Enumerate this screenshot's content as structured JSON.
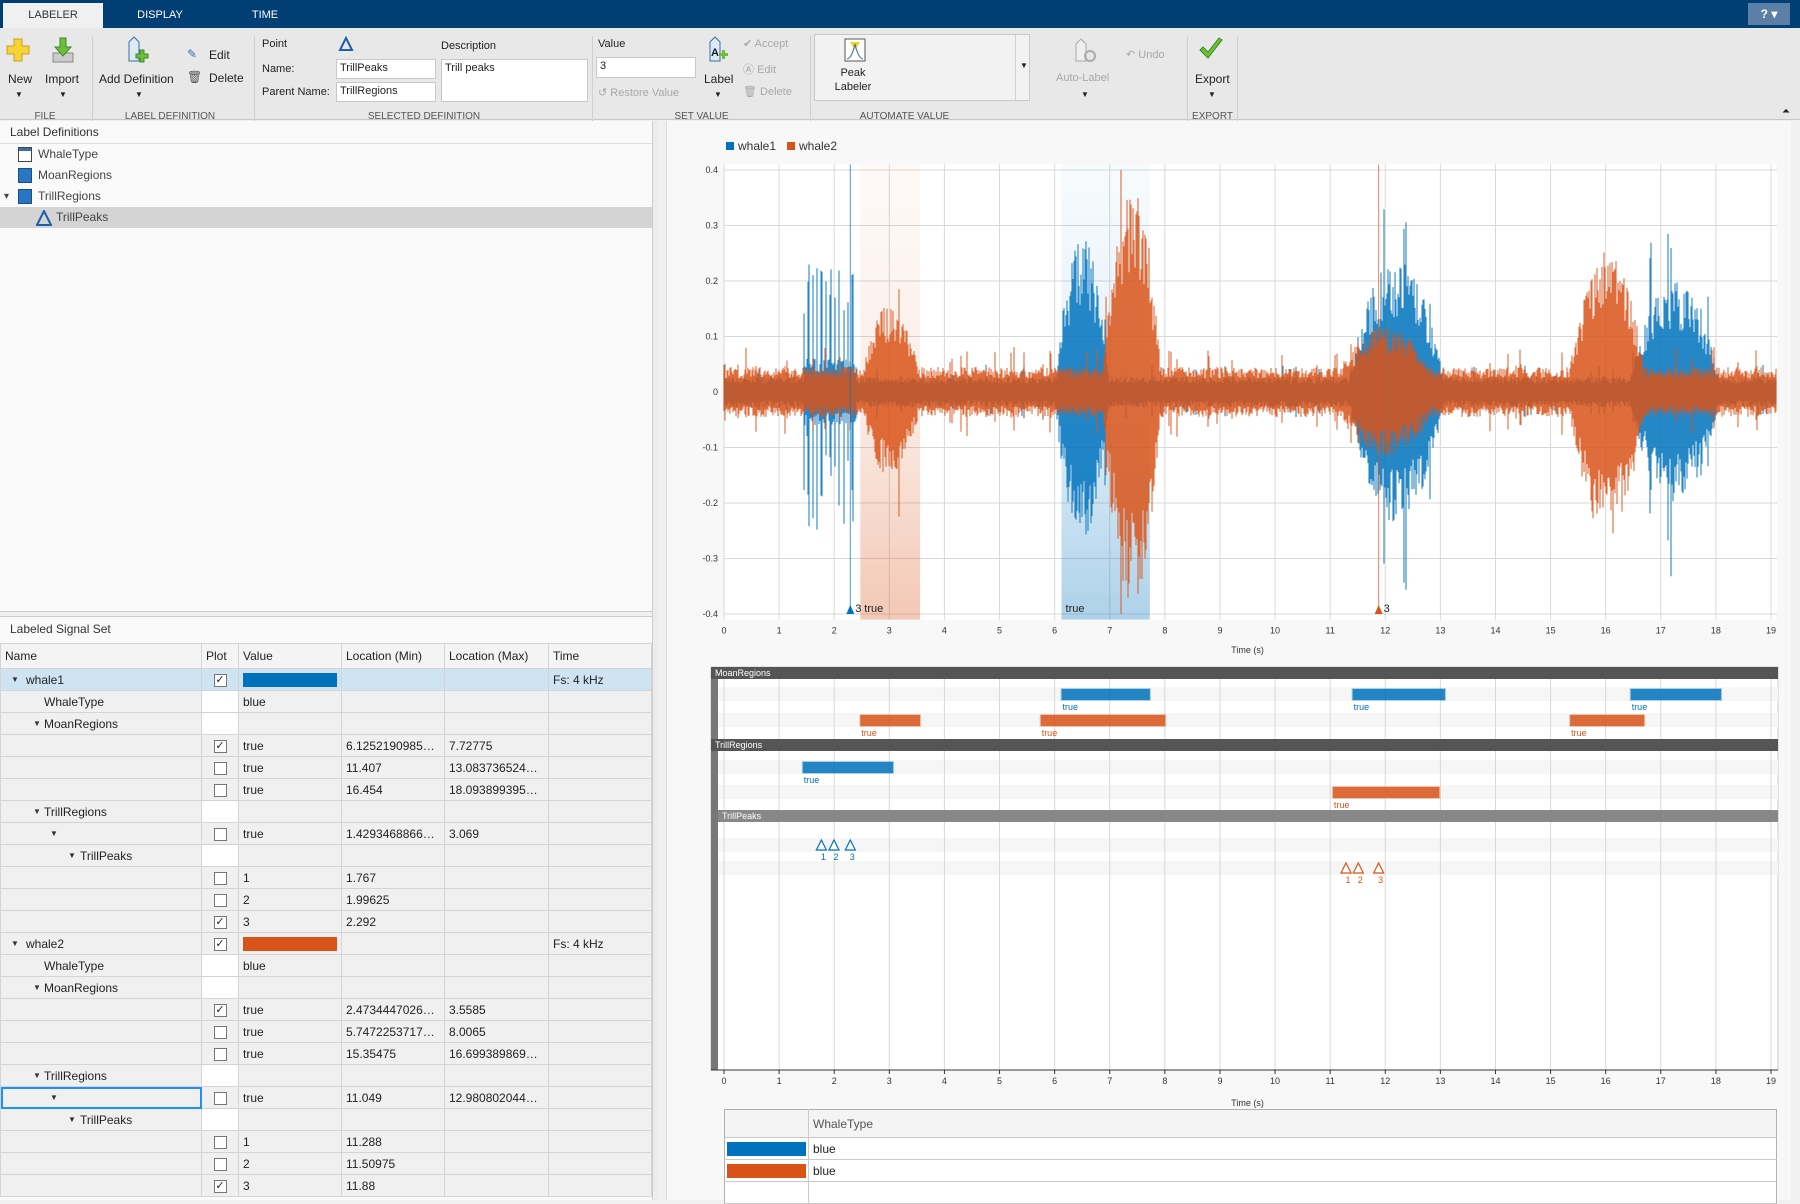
{
  "tabs": [
    {
      "label": "LABELER",
      "active": true
    },
    {
      "label": "DISPLAY"
    },
    {
      "label": "TIME"
    }
  ],
  "help": "?",
  "toolstrip": {
    "file": {
      "section": "FILE",
      "new": "New",
      "import": "Import"
    },
    "label_definition": {
      "section": "LABEL DEFINITION",
      "add": "Add Definition",
      "edit": "Edit",
      "delete": "Delete"
    },
    "selected_definition": {
      "section": "SELECTED DEFINITION",
      "type": "Point",
      "name_label": "Name:",
      "name_value": "TrillPeaks",
      "parent_label": "Parent Name:",
      "parent_value": "TrillRegions",
      "description_label": "Description",
      "description_value": "Trill peaks"
    },
    "set_value": {
      "section": "SET VALUE",
      "value_label": "Value",
      "value": "3",
      "restore": "Restore Value",
      "label": "Label",
      "accept": "Accept",
      "edit": "Edit",
      "delete": "Delete"
    },
    "automate_value": {
      "section": "AUTOMATE VALUE",
      "peak_labeler": "Peak",
      "peak_labeler2": "Labeler",
      "auto_label": "Auto-Label",
      "undo": "Undo"
    },
    "export": {
      "section": "EXPORT",
      "export": "Export"
    }
  },
  "label_definitions": {
    "title": "Label Definitions",
    "items": [
      {
        "name": "WhaleType",
        "icon": "attribute-icon"
      },
      {
        "name": "MoanRegions",
        "icon": "roi-icon"
      },
      {
        "name": "TrillRegions",
        "icon": "roi-icon",
        "expanded": true
      },
      {
        "name": "TrillPeaks",
        "icon": "point-icon",
        "selected": true
      }
    ]
  },
  "signal_set": {
    "title": "Labeled Signal Set",
    "columns": [
      "Name",
      "Plot",
      "Value",
      "Location (Min)",
      "Location (Max)",
      "Time"
    ],
    "rows": [
      {
        "name": "whale1",
        "level": 0,
        "exp": true,
        "plot": true,
        "color": "#0072BD",
        "time": "Fs: 4 kHz",
        "highlight": true
      },
      {
        "name": "WhaleType",
        "level": 1,
        "value": "blue"
      },
      {
        "name": "MoanRegions",
        "level": 1,
        "exp": true
      },
      {
        "name": "",
        "level": 2,
        "plot": true,
        "value": "true",
        "min": "6.12521909851…",
        "max": "7.72775"
      },
      {
        "name": "",
        "level": 2,
        "plot": false,
        "value": "true",
        "min": "11.407",
        "max": "13.0837365241…"
      },
      {
        "name": "",
        "level": 2,
        "plot": false,
        "value": "true",
        "min": "16.454",
        "max": "18.0938993959…"
      },
      {
        "name": "TrillRegions",
        "level": 1,
        "exp": true
      },
      {
        "name": "",
        "level": 2,
        "exp": true,
        "plot": false,
        "value": "true",
        "min": "1.42934688661…",
        "max": "3.069"
      },
      {
        "name": "TrillPeaks",
        "level": 3,
        "exp": true
      },
      {
        "name": "",
        "level": 3,
        "plot": false,
        "value": "1",
        "min": "1.767"
      },
      {
        "name": "",
        "level": 3,
        "plot": false,
        "value": "2",
        "min": "1.99625"
      },
      {
        "name": "",
        "level": 3,
        "plot": true,
        "value": "3",
        "min": "2.292"
      },
      {
        "name": "whale2",
        "level": 0,
        "exp": true,
        "plot": true,
        "color": "#D95319",
        "time": "Fs: 4 kHz"
      },
      {
        "name": "WhaleType",
        "level": 1,
        "value": "blue"
      },
      {
        "name": "MoanRegions",
        "level": 1,
        "exp": true
      },
      {
        "name": "",
        "level": 2,
        "plot": true,
        "value": "true",
        "min": "2.47344470260…",
        "max": "3.5585"
      },
      {
        "name": "",
        "level": 2,
        "plot": false,
        "value": "true",
        "min": "5.74722537174…",
        "max": "8.0065"
      },
      {
        "name": "",
        "level": 2,
        "plot": false,
        "value": "true",
        "min": "15.35475",
        "max": "16.6993898698…"
      },
      {
        "name": "TrillRegions",
        "level": 1,
        "exp": true
      },
      {
        "name": "",
        "level": 2,
        "exp": true,
        "plot": false,
        "value": "true",
        "min": "11.049",
        "max": "12.9808020446…",
        "focused": true
      },
      {
        "name": "TrillPeaks",
        "level": 3,
        "exp": true
      },
      {
        "name": "",
        "level": 3,
        "plot": false,
        "value": "1",
        "min": "11.288"
      },
      {
        "name": "",
        "level": 3,
        "plot": false,
        "value": "2",
        "min": "11.50975"
      },
      {
        "name": "",
        "level": 3,
        "plot": true,
        "value": "3",
        "min": "11.88"
      }
    ]
  },
  "colors": {
    "whale1": "#0072BD",
    "whale2": "#D95319",
    "toolbar": "#003e74"
  },
  "chart_data": [
    {
      "type": "line",
      "legend": [
        "whale1",
        "whale2"
      ],
      "legend_placement": "top-left",
      "xlabel": "Time (s)",
      "xlim": [
        0,
        19.12
      ],
      "ylim": [
        -0.4,
        0.41
      ],
      "xticks": [
        0,
        1,
        2,
        3,
        4,
        5,
        6,
        7,
        8,
        9,
        10,
        11,
        12,
        13,
        14,
        15,
        16,
        17,
        18,
        19
      ],
      "yticks": [
        -0.4,
        -0.3,
        -0.2,
        -0.1,
        0,
        0.1,
        0.2,
        0.3,
        0.4
      ],
      "grid": true,
      "regions": [
        {
          "series": "whale2",
          "start": 2.47344,
          "end": 3.5585,
          "label": "true"
        },
        {
          "series": "whale1",
          "start": 6.12522,
          "end": 7.72775,
          "label": "true"
        }
      ],
      "points": [
        {
          "series": "whale1",
          "x": 2.292,
          "label": "3"
        },
        {
          "series": "whale2",
          "x": 11.88,
          "label": "3"
        }
      ]
    },
    {
      "type": "timeline",
      "xlabel": "Time (s)",
      "xlim": [
        0,
        19.12
      ],
      "groups": [
        {
          "name": "MoanRegions",
          "kind": "region",
          "lanes": [
            {
              "series": "whale1",
              "items": [
                [
                  6.12522,
                  7.72775,
                  "true"
                ],
                [
                  11.407,
                  13.08374,
                  "true"
                ],
                [
                  16.454,
                  18.0939,
                  "true"
                ]
              ]
            },
            {
              "series": "whale2",
              "items": [
                [
                  2.47344,
                  3.5585,
                  "true"
                ],
                [
                  5.74723,
                  8.0065,
                  "true"
                ],
                [
                  15.35475,
                  16.69939,
                  "true"
                ]
              ]
            }
          ]
        },
        {
          "name": "TrillRegions",
          "kind": "region",
          "lanes": [
            {
              "series": "whale1",
              "items": [
                [
                  1.42935,
                  3.069,
                  "true"
                ]
              ]
            },
            {
              "series": "whale2",
              "items": [
                [
                  11.049,
                  12.9808,
                  "true"
                ]
              ]
            }
          ]
        },
        {
          "name": "TrillPeaks",
          "kind": "point",
          "lanes": [
            {
              "series": "whale1",
              "items": [
                [
                  1.767,
                  "1"
                ],
                [
                  1.99625,
                  "2"
                ],
                [
                  2.292,
                  "3"
                ]
              ]
            },
            {
              "series": "whale2",
              "items": [
                [
                  11.288,
                  "1"
                ],
                [
                  11.50975,
                  "2"
                ],
                [
                  11.88,
                  "3"
                ]
              ]
            }
          ]
        }
      ]
    }
  ],
  "attribute_table": {
    "header": "WhaleType",
    "rows": [
      {
        "color": "#0072BD",
        "value": "blue"
      },
      {
        "color": "#D95319",
        "value": "blue"
      }
    ]
  }
}
